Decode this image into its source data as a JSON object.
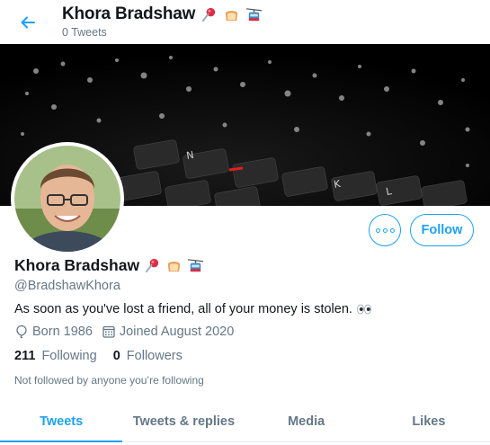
{
  "header": {
    "name": "Khora Bradshaw",
    "tweet_count": "0 Tweets",
    "name_emojis": [
      "pushpin-icon",
      "bread-icon",
      "aerial-tramway-icon"
    ]
  },
  "profile": {
    "display_name": "Khora Bradshaw",
    "handle": "@BradshawKhora",
    "bio": "As soon as you've lost a friend, all of your money is stolen.",
    "bio_emoji": "eyes-icon",
    "born": "Born 1986",
    "joined": "Joined August 2020",
    "following_count": "211",
    "following_label": "Following",
    "followers_count": "0",
    "followers_label": "Followers",
    "followed_by": "Not followed by anyone you’re following"
  },
  "actions": {
    "follow_label": "Follow"
  },
  "tabs": [
    {
      "label": "Tweets",
      "active": true
    },
    {
      "label": "Tweets & replies",
      "active": false
    },
    {
      "label": "Media",
      "active": false
    },
    {
      "label": "Likes",
      "active": false
    }
  ],
  "colors": {
    "accent": "#1da1f2",
    "secondary_text": "#657786",
    "primary_text": "#14171a"
  }
}
